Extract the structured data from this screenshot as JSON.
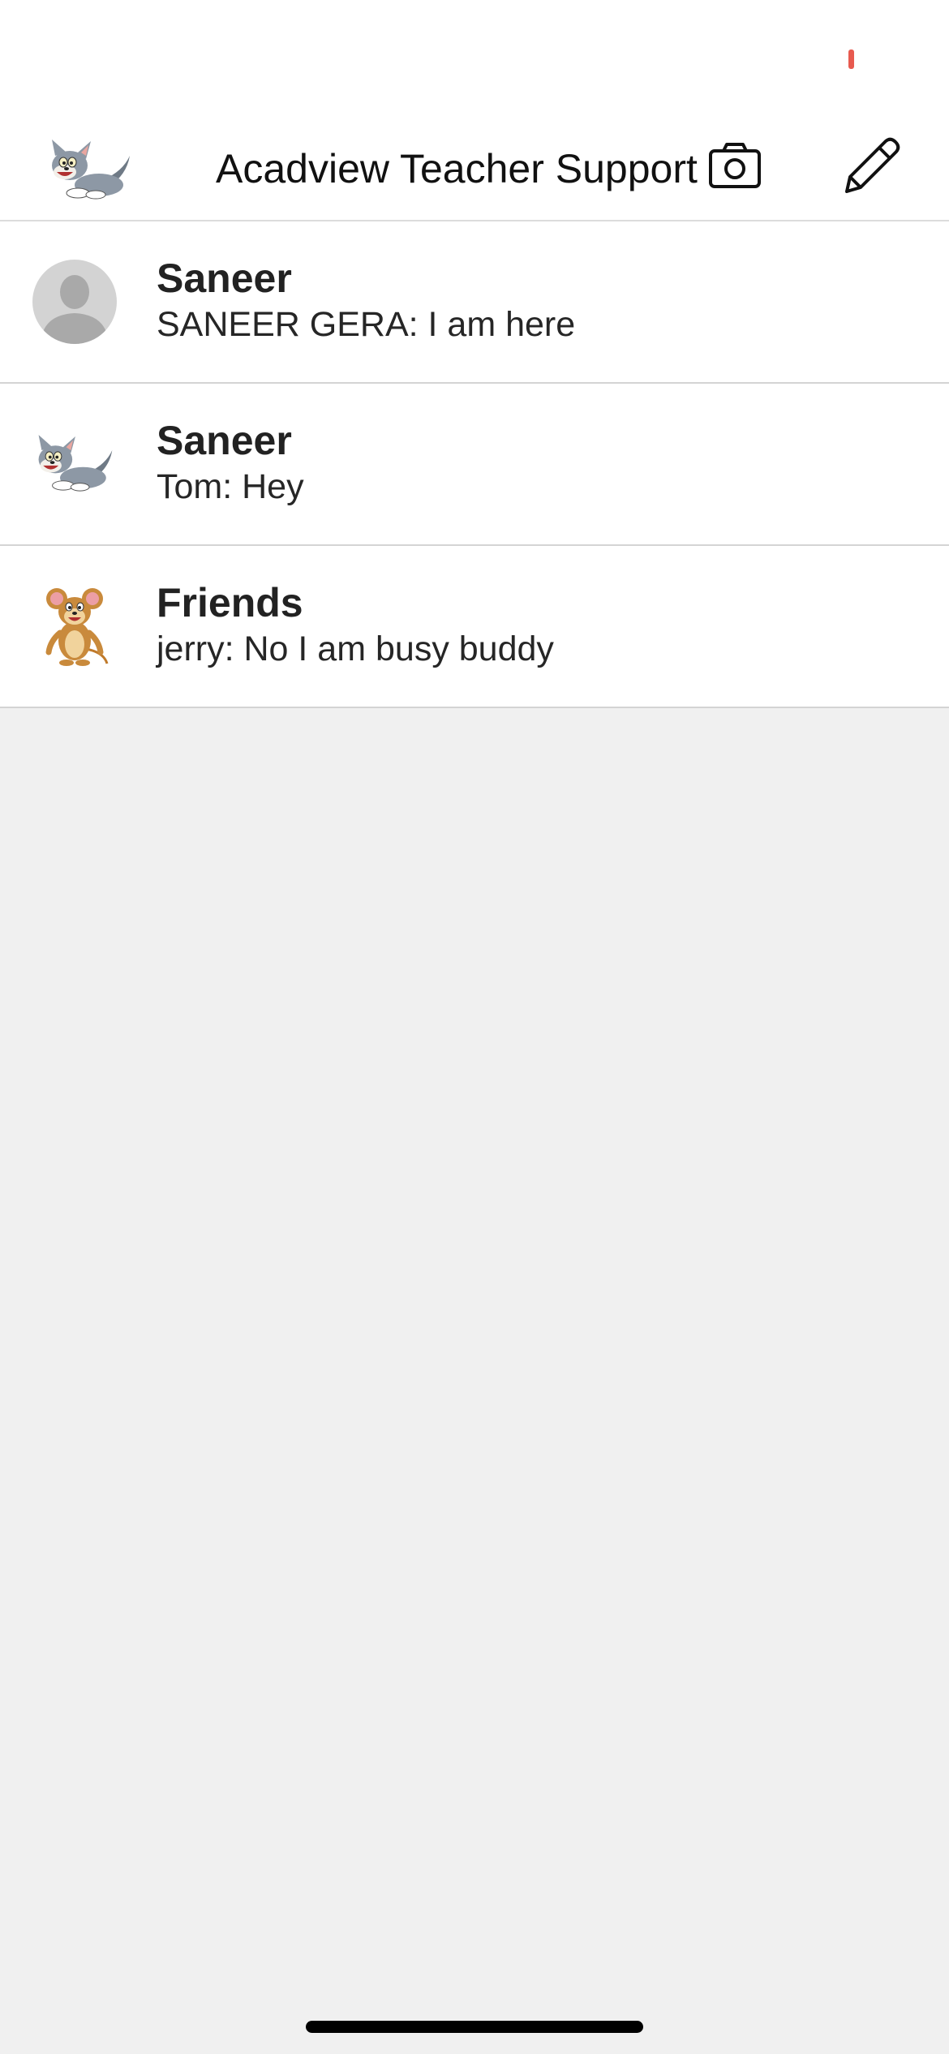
{
  "status_bar": {
    "indicator_color": "#e85a4f"
  },
  "header": {
    "avatar_icon": "tom-cat-avatar-icon",
    "title": "Acadview Teacher Support",
    "camera_icon": "camera-icon",
    "compose_icon": "pencil-icon"
  },
  "chats": [
    {
      "name": "Saneer",
      "preview": "SANEER GERA: I am here",
      "avatar_icon": "default-person-avatar-icon"
    },
    {
      "name": "Saneer",
      "preview": "Tom: Hey",
      "avatar_icon": "tom-cat-avatar-icon"
    },
    {
      "name": "Friends",
      "preview": "jerry: No I am busy buddy",
      "avatar_icon": "jerry-mouse-avatar-icon"
    }
  ],
  "colors": {
    "header_background": "#ffffff",
    "list_background": "#f0f0f0",
    "divider": "#d4d4d4",
    "text_primary": "#222222"
  }
}
